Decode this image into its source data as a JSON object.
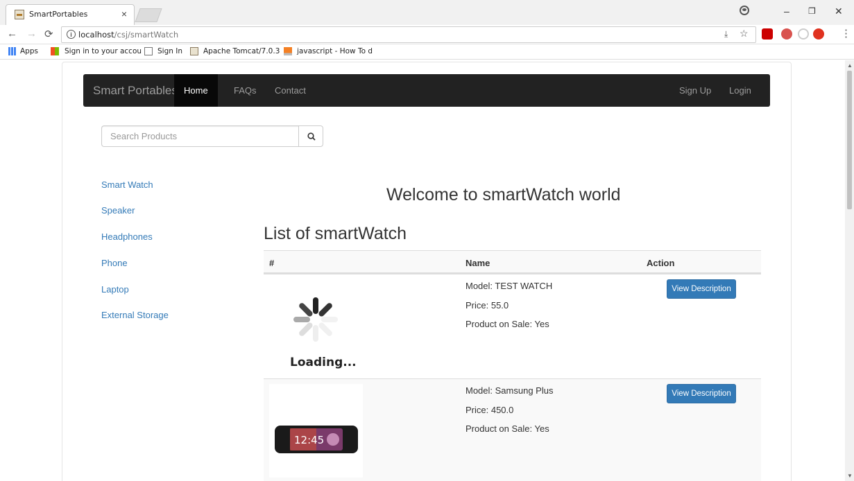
{
  "browser": {
    "tab_title": "SmartPortables",
    "tab_close": "×",
    "url_host": "localhost",
    "url_path": "/csj/smartWatch",
    "window_controls": [
      "–",
      "❐",
      "✕"
    ],
    "bookmarks": [
      {
        "label": "Apps",
        "icon": "apps-grid-icon"
      },
      {
        "label": "Sign in to your accou",
        "icon": "microsoft-icon"
      },
      {
        "label": "Sign In",
        "icon": "page-icon"
      },
      {
        "label": "Apache Tomcat/7.0.3",
        "icon": "tomcat-icon"
      },
      {
        "label": "javascript - How To d",
        "icon": "stackoverflow-icon"
      }
    ]
  },
  "navbar": {
    "brand": "Smart Portables",
    "links": [
      "Home",
      "FAQs",
      "Contact"
    ],
    "right_links": [
      "Sign Up",
      "Login"
    ],
    "active": "Home"
  },
  "search": {
    "placeholder": "Search Products"
  },
  "sidebar": {
    "items": [
      "Smart Watch",
      "Speaker",
      "Headphones",
      "Phone",
      "Laptop",
      "External Storage"
    ]
  },
  "main": {
    "welcome": "Welcome to smartWatch world",
    "list_title": "List of smartWatch",
    "columns": [
      "#",
      "Name",
      "Action"
    ],
    "products": [
      {
        "model": "Model: TEST WATCH",
        "price": "Price: 55.0",
        "sale": "Product on Sale: Yes",
        "button": "View Description",
        "image_text": "Loading..."
      },
      {
        "model": "Model: Samsung Plus",
        "price": "Price: 450.0",
        "sale": "Product on Sale: Yes",
        "button": "View Description",
        "image_text": "12:45"
      }
    ]
  },
  "colors": {
    "navbar_bg": "#222222",
    "link": "#337ab7",
    "button": "#337ab7"
  }
}
